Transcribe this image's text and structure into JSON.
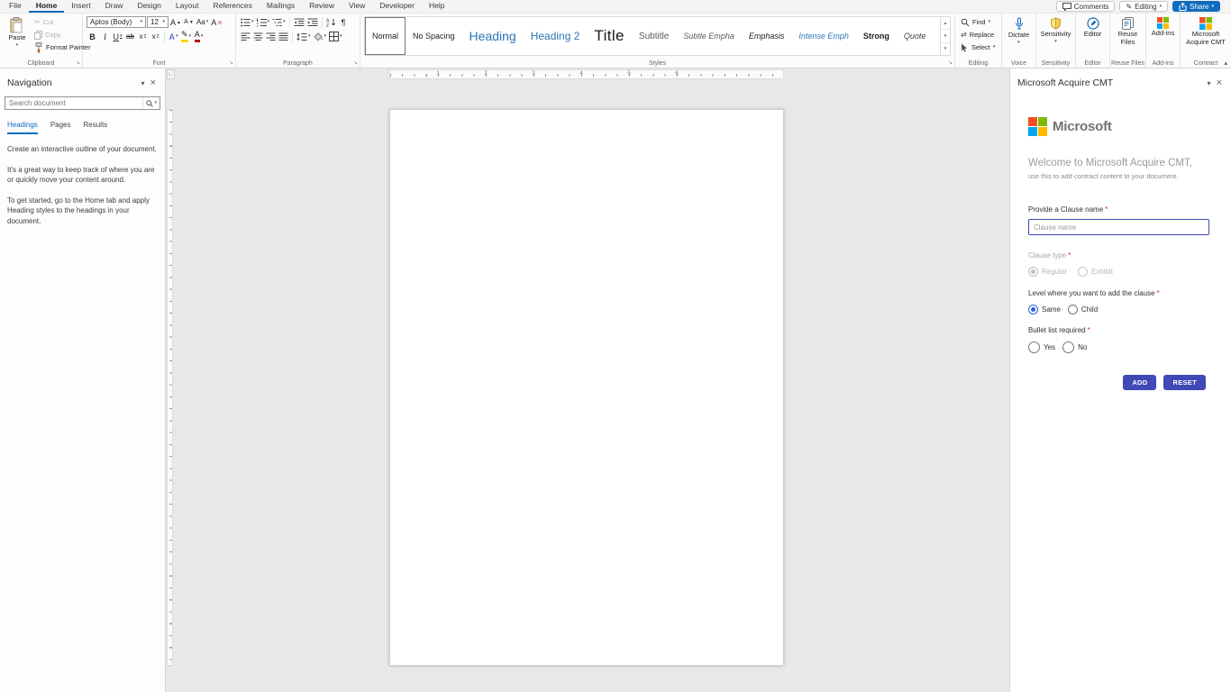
{
  "colors": {
    "accent": "#0f6cbd",
    "button-indigo": "#4049b5",
    "heading-blue": "#2e74b5",
    "ms-red": "#f25022",
    "ms-green": "#7fba00",
    "ms-blue": "#00a4ef",
    "ms-yellow": "#ffb900",
    "radio-selected": "#2b5fd9",
    "required-red": "#c42b1c"
  },
  "tabrow": {
    "tabs": [
      "File",
      "Home",
      "Insert",
      "Draw",
      "Design",
      "Layout",
      "References",
      "Mailings",
      "Review",
      "View",
      "Developer",
      "Help"
    ],
    "active_tab": "Home",
    "comments": "Comments",
    "editing": "Editing",
    "share": "Share"
  },
  "ribbon": {
    "clipboard": {
      "label": "Clipboard",
      "paste": "Paste",
      "cut": "Cut",
      "copy": "Copy",
      "format_painter": "Format Painter"
    },
    "font": {
      "label": "Font",
      "family": "Aptos (Body)",
      "size": "12"
    },
    "paragraph": {
      "label": "Paragraph"
    },
    "styles": {
      "label": "Styles",
      "items": [
        "Normal",
        "No Spacing",
        "Heading",
        "Heading 2",
        "Title",
        "Subtitle",
        "Subtle Empha",
        "Emphasis",
        "Intense Emph",
        "Strong",
        "Quote"
      ],
      "selected": "Normal"
    },
    "editing_group": {
      "label": "Editing",
      "find": "Find",
      "replace": "Replace",
      "select": "Select"
    },
    "voice": {
      "label": "Voice",
      "dictate": "Dictate"
    },
    "sensitivity": {
      "label": "Sensitivity",
      "button": "Sensitivity"
    },
    "editor": {
      "label": "Editor",
      "button": "Editor"
    },
    "reuse_files": {
      "label": "Reuse Files",
      "button": "Reuse Files"
    },
    "addins": {
      "label": "Add-ins",
      "button": "Add-ins"
    },
    "contract": {
      "label": "Contract",
      "button": "Microsoft Acquire CMT"
    }
  },
  "navigation": {
    "title": "Navigation",
    "search_placeholder": "Search document",
    "tabs": [
      "Headings",
      "Pages",
      "Results"
    ],
    "active_tab": "Headings",
    "paragraphs": [
      "Create an interactive outline of your document.",
      "It's a great way to keep track of where you are or quickly move your content around.",
      "To get started, go to the Home tab and apply Heading styles to the headings in your document."
    ]
  },
  "document": {
    "ruler_numbers": [
      "1",
      "2",
      "3",
      "4",
      "5",
      "6"
    ]
  },
  "taskpane": {
    "title": "Microsoft Acquire CMT",
    "logo_text": "Microsoft",
    "welcome": "Welcome to Microsoft Acquire CMT,",
    "tagline": "use this to add contract content to your document.",
    "required_marker": "*",
    "clause_name": {
      "label": "Provide a Clause name",
      "placeholder": "Clause name",
      "value": ""
    },
    "clause_type": {
      "label": "Clause type",
      "options": [
        "Regular",
        "Exhibit"
      ],
      "selected": "Regular",
      "disabled": true
    },
    "level": {
      "label": "Level where you want to add the clause",
      "options": [
        "Same",
        "Child"
      ],
      "selected": "Same"
    },
    "bullet_list": {
      "label": "Bullet list required",
      "options": [
        "Yes",
        "No"
      ],
      "selected": ""
    },
    "buttons": {
      "add": "ADD",
      "reset": "RESET"
    }
  }
}
